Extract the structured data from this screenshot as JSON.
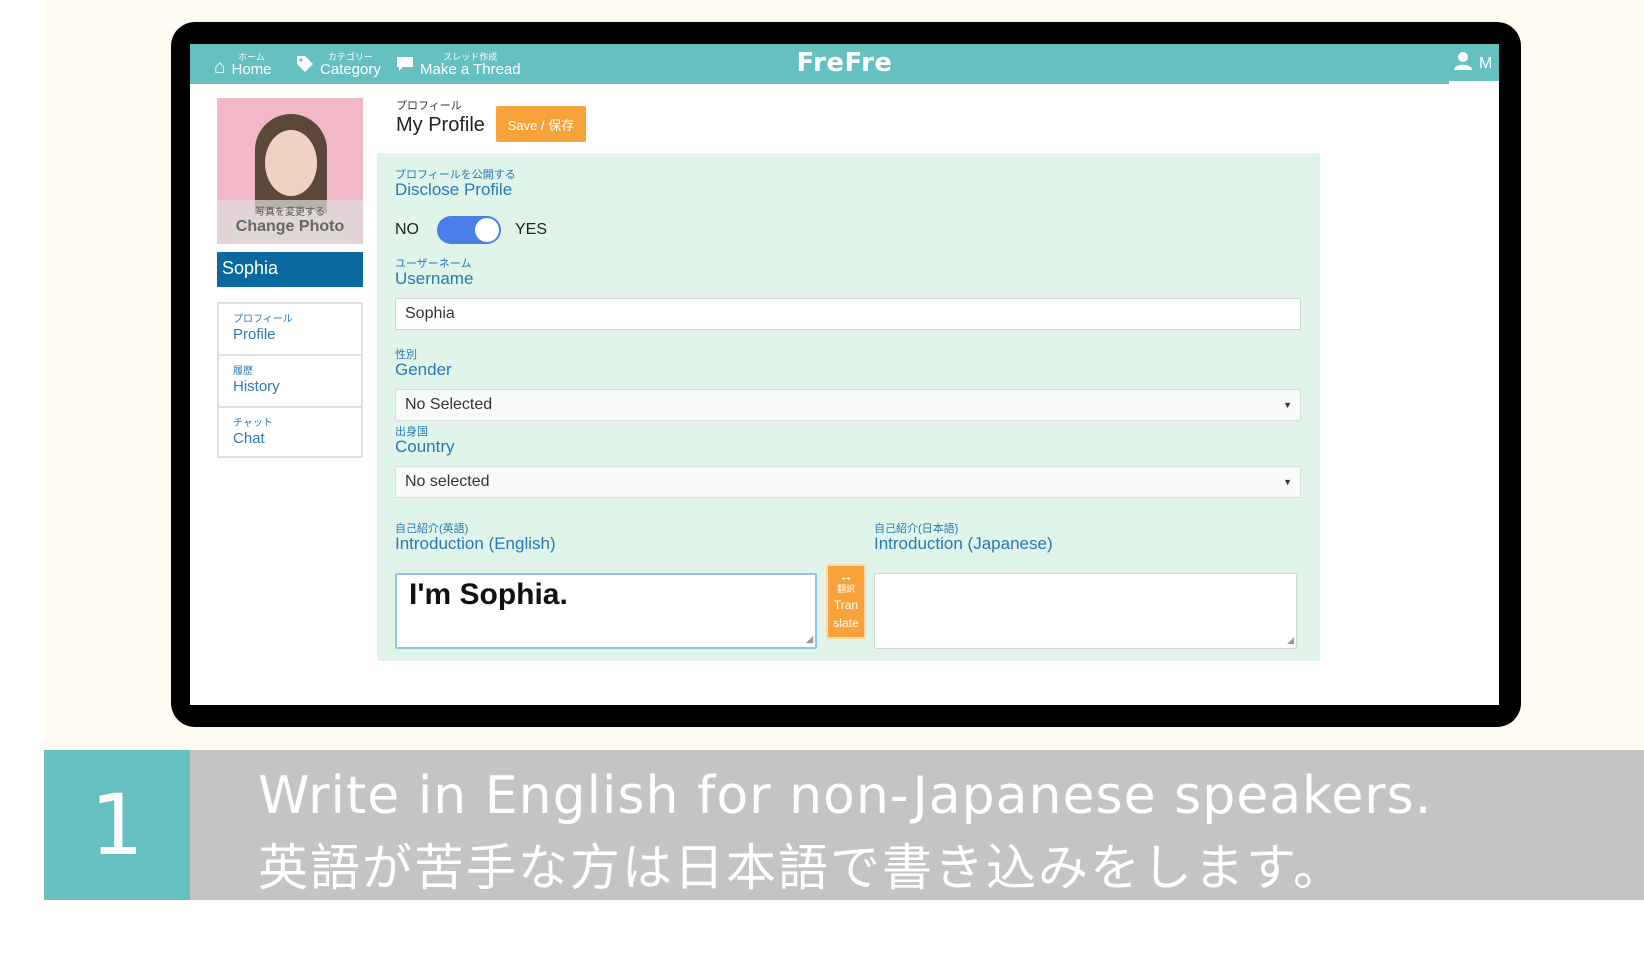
{
  "navbar": {
    "items": [
      {
        "sub": "ホーム",
        "label": "Home",
        "icon": "home-icon"
      },
      {
        "sub": "カテゴリー",
        "label": "Category",
        "icon": "tag-icon"
      },
      {
        "sub": "スレッド作成",
        "label": "Make a Thread",
        "icon": "speech-bubble-icon"
      }
    ],
    "brand": "FreFre",
    "user_initial": "M",
    "accent": "#66c0c0"
  },
  "sidebar": {
    "photo_jp": "写真を変更する",
    "photo_en": "Change Photo",
    "username": "Sophia",
    "menu": [
      {
        "jp": "プロフィール",
        "en": "Profile"
      },
      {
        "jp": "履歴",
        "en": "History"
      },
      {
        "jp": "チャット",
        "en": "Chat"
      }
    ]
  },
  "profile": {
    "sub": "プロフィール",
    "title": "My Profile",
    "save_label": "Save / 保存"
  },
  "form": {
    "disclose_jp": "プロフィールを公開する",
    "disclose_en": "Disclose Profile",
    "toggle_no": "NO",
    "toggle_yes": "YES",
    "toggle_state": "on",
    "username_jp": "ユーザーネーム",
    "username_en": "Username",
    "username_value": "Sophia",
    "gender_jp": "性別",
    "gender_en": "Gender",
    "gender_value": "No Selected",
    "country_jp": "出身国",
    "country_en": "Country",
    "country_value": "No selected",
    "intro_en_jp": "自己紹介(英語)",
    "intro_en_label": "Introduction (English)",
    "intro_en_value": "I'm Sophia.",
    "intro_ja_jp": "自己紹介(日本語)",
    "intro_ja_label": "Introduction (Japanese)",
    "intro_ja_value": "",
    "translate_jp": "翻訳",
    "translate_en_1": "Tran",
    "translate_en_2": "slate"
  },
  "caption": {
    "number": "1",
    "line1": "Write in English for non-Japanese speakers.",
    "line2": "英語が苦手な方は日本語で書き込みをします。"
  }
}
